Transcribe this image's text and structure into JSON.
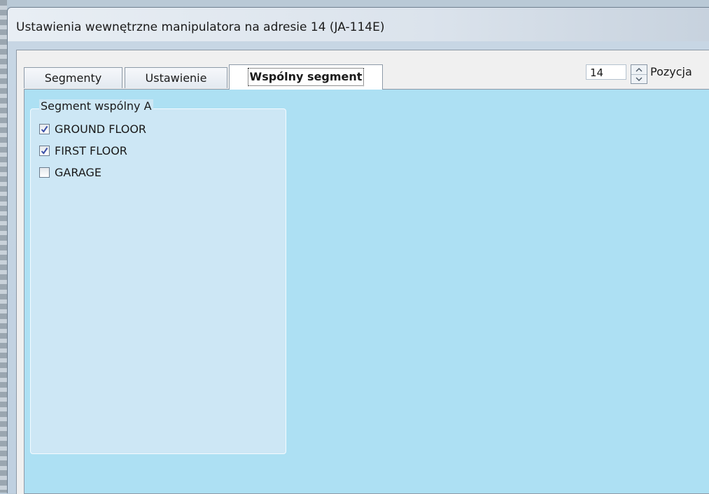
{
  "window": {
    "title": "Ustawienia wewnętrzne manipulatora na adresie 14 (JA-114E)"
  },
  "tabs": [
    {
      "label": "Segmenty",
      "active": false
    },
    {
      "label": "Ustawienie",
      "active": false
    },
    {
      "label": "Wspólny segment",
      "active": true
    }
  ],
  "position": {
    "value": "14",
    "label": "Pozycja"
  },
  "group": {
    "title": "Segment wspólny A",
    "items": [
      {
        "label": "GROUND FLOOR",
        "checked": true
      },
      {
        "label": "FIRST FLOOR",
        "checked": true
      },
      {
        "label": "GARAGE",
        "checked": false
      }
    ]
  },
  "colors": {
    "panel_background": "#ade0f3",
    "group_background": "#cde7f5",
    "checkmark": "#3a4fa8"
  },
  "icons": [
    "checkmark-icon",
    "arrow-up-icon",
    "arrow-down-icon"
  ]
}
